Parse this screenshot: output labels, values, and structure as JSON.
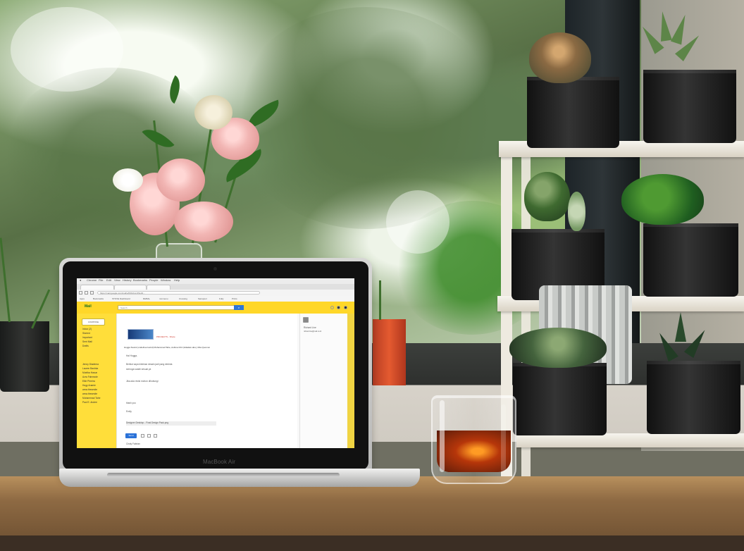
{
  "scene": {
    "laptop_brand": "MacBook Air"
  },
  "browser": {
    "menu_items": [
      "Chrome",
      "File",
      "Edit",
      "View",
      "History",
      "Bookmarks",
      "People",
      "Window",
      "Help"
    ],
    "tab_label": "Mail",
    "address": "https://mail.google.com/mail/u/0/#inbox/15e34...",
    "bookmarks": [
      "Apps",
      "Bookmarks",
      "STOVE Dashboard",
      "RHBAL",
      "mmmenu",
      "Crossing",
      "Sanspool",
      "Fully",
      "Prints"
    ]
  },
  "mail": {
    "logo": "Mail",
    "search_placeholder": "Search",
    "compose": "COMPOSE",
    "nav_items": [
      "Inbox (2)",
      "Starred",
      "Important",
      "Sent Mail",
      "Drafts",
      "Jenny Diadema",
      "Lauren Bashka",
      "Mutrika Hasun",
      "Azra Fahreade",
      "Ellie Pirreira",
      "Hugy Aramie",
      "www.thesesite",
      "www.thesesite",
      "Muhammad Tahe",
      "Paul E. Andee"
    ],
    "subject": "Hugga Suarol (undefined ad.id) Muhammad Tahe, Aubina Chiz (Hiladelo abo), Rita Quomon",
    "greeting": "Hai Hugga,",
    "body_lines": [
      "Berikut saya kirimkan desain jadi yang diminta",
      "semoga sudah sesuai ya",
      "Jika ada revisi mohon dihubungi",
      "thank you",
      "Emily"
    ],
    "attachment": "PROJECTS - Share",
    "attachment_file": "Designer Desktop - Final Design Pack.png",
    "send": "Send",
    "contact_name": "Richard Live",
    "contact_email": "richard.live@mail.co.id",
    "footer_name": "Cindy Fabrian"
  }
}
